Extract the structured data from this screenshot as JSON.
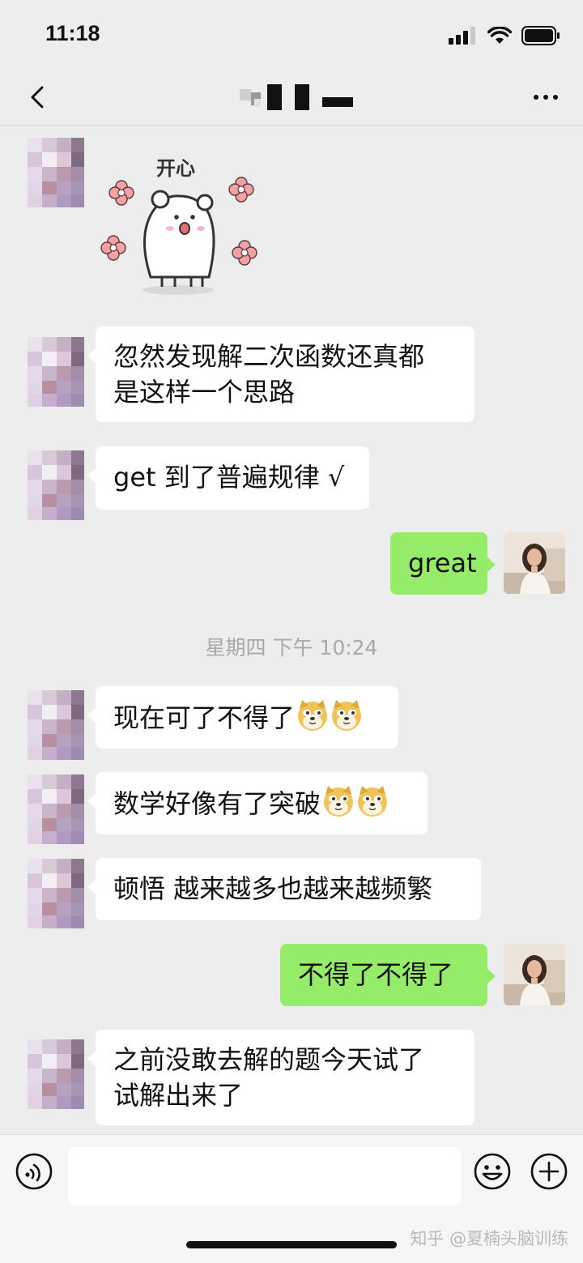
{
  "status_bar": {
    "time": "11:18"
  },
  "nav": {
    "title": ""
  },
  "messages": [
    {
      "id": "m1",
      "sender": "contact",
      "type": "sticker",
      "text": "开心"
    },
    {
      "id": "m2",
      "sender": "contact",
      "type": "text",
      "lines": [
        "忽然发现解二次函数还真都",
        "是这样一个思路"
      ]
    },
    {
      "id": "m3",
      "sender": "contact",
      "type": "text",
      "lines": [
        "get 到了普遍规律 √"
      ]
    },
    {
      "id": "m4",
      "sender": "me",
      "type": "text",
      "lines": [
        "great"
      ]
    },
    {
      "id": "m5",
      "sender": "contact",
      "type": "text",
      "lines": [
        "现在可了不得了"
      ],
      "emoji": [
        "doge-icon",
        "doge-icon"
      ]
    },
    {
      "id": "m6",
      "sender": "contact",
      "type": "text",
      "lines": [
        "数学好像有了突破"
      ],
      "emoji": [
        "doge-icon",
        "doge-icon"
      ]
    },
    {
      "id": "m7",
      "sender": "contact",
      "type": "text",
      "lines": [
        "顿悟 越来越多也越来越频繁"
      ]
    },
    {
      "id": "m8",
      "sender": "me",
      "type": "text",
      "lines": [
        "不得了不得了"
      ]
    },
    {
      "id": "m9",
      "sender": "contact",
      "type": "text",
      "lines": [
        "之前没敢去解的题今天试了",
        "试解出来了"
      ]
    }
  ],
  "timestamp": "星期四 下午 10:24",
  "input": {
    "value": ""
  },
  "watermark": "知乎 @夏楠头脑训练",
  "colors": {
    "background": "#ededed",
    "bubble_me": "#95ec69",
    "bubble_contact": "#ffffff"
  }
}
